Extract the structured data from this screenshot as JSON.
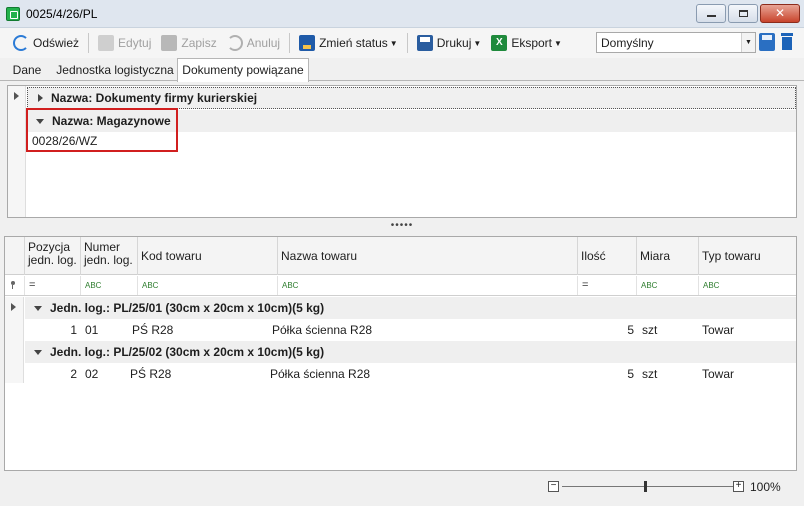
{
  "window": {
    "title": "0025/4/26/PL"
  },
  "toolbar": {
    "refresh": "Odśwież",
    "edit": "Edytuj",
    "save": "Zapisz",
    "cancel": "Anuluj",
    "change_status": "Zmień status",
    "print": "Drukuj",
    "export": "Eksport",
    "layout_value": "Domyślny",
    "excel_glyph": "X"
  },
  "tabs": [
    "Dane",
    "Jednostka logistyczna",
    "Dokumenty powiązane"
  ],
  "related_docs": {
    "groups": [
      {
        "label": "Nazwa: Dokumenty firmy kurierskiej",
        "expanded": false
      },
      {
        "label": "Nazwa: Magazynowe",
        "expanded": true
      }
    ],
    "documents": [
      "0028/26/WZ"
    ]
  },
  "splitter_glyph": "•••••",
  "grid": {
    "columns": [
      "Pozycja jedn. log.",
      "Numer jedn. log.",
      "Kod towaru",
      "Nazwa towaru",
      "Ilość",
      "Miara",
      "Typ towaru"
    ],
    "filter_glyph_eq": "=",
    "filter_glyph_abc": "ABC",
    "groups": [
      {
        "label": "Jedn. log.: PL/25/01 (30cm x 20cm x 10cm)(5 kg)",
        "rows": [
          {
            "pos": "1",
            "num": "01",
            "code": "PŚ R28",
            "name": "Półka ścienna R28",
            "qty": "5",
            "unit": "szt",
            "type": "Towar"
          }
        ]
      },
      {
        "label": "Jedn. log.: PL/25/02 (30cm x 20cm x 10cm)(5 kg)",
        "rows": [
          {
            "pos": "2",
            "num": "02",
            "code": "PŚ R28",
            "name": "Półka ścienna R28",
            "qty": "5",
            "unit": "szt",
            "type": "Towar"
          }
        ]
      }
    ]
  },
  "zoom": {
    "value": "100%",
    "level": 100,
    "minus": "−",
    "plus": "+"
  },
  "colors": {
    "highlight_box": "#d11f1f",
    "accent": "#2c7bd6"
  }
}
